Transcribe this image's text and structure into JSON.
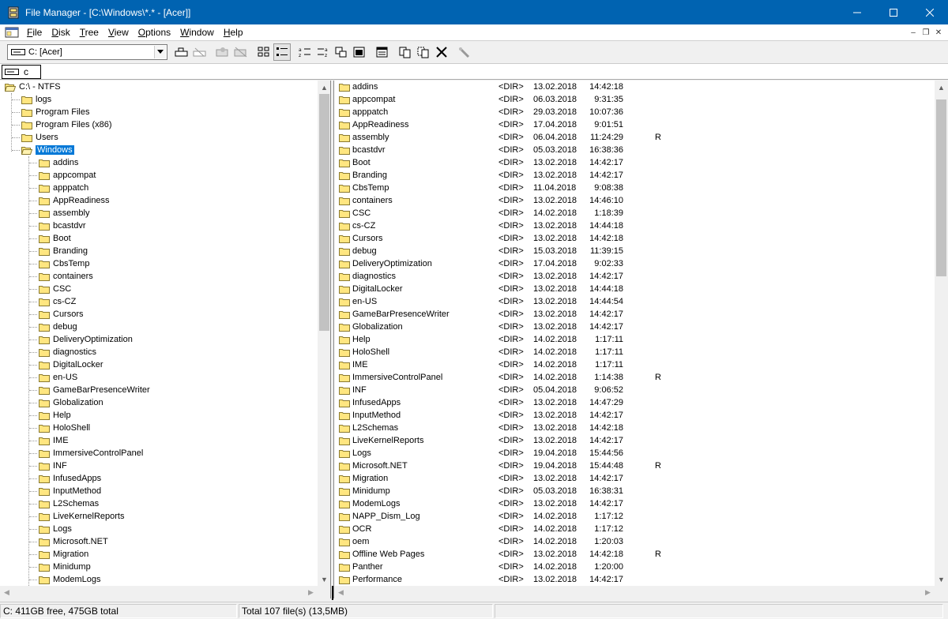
{
  "window": {
    "title": "File Manager - [C:\\Windows\\*.* - [Acer]]"
  },
  "menu": [
    {
      "key": "F",
      "rest": "ile"
    },
    {
      "key": "D",
      "rest": "isk"
    },
    {
      "key": "T",
      "rest": "ree"
    },
    {
      "key": "V",
      "rest": "iew"
    },
    {
      "key": "O",
      "rest": "ptions"
    },
    {
      "key": "W",
      "rest": "indow"
    },
    {
      "key": "H",
      "rest": "elp"
    }
  ],
  "drive_select": {
    "value": "C: [Acer]"
  },
  "drive_tab": {
    "label": "c"
  },
  "tree": {
    "root": "C:\\ - NTFS",
    "top_folders": [
      "logs",
      "Program Files",
      "Program Files (x86)",
      "Users"
    ],
    "selected": "Windows",
    "children": [
      "addins",
      "appcompat",
      "apppatch",
      "AppReadiness",
      "assembly",
      "bcastdvr",
      "Boot",
      "Branding",
      "CbsTemp",
      "containers",
      "CSC",
      "cs-CZ",
      "Cursors",
      "debug",
      "DeliveryOptimization",
      "diagnostics",
      "DigitalLocker",
      "en-US",
      "GameBarPresenceWriter",
      "Globalization",
      "Help",
      "HoloShell",
      "IME",
      "ImmersiveControlPanel",
      "INF",
      "InfusedApps",
      "InputMethod",
      "L2Schemas",
      "LiveKernelReports",
      "Logs",
      "Microsoft.NET",
      "Migration",
      "Minidump",
      "ModemLogs"
    ]
  },
  "files": [
    {
      "name": "addins",
      "type": "<DIR>",
      "date": "13.02.2018",
      "time": "14:42:18",
      "attr": ""
    },
    {
      "name": "appcompat",
      "type": "<DIR>",
      "date": "06.03.2018",
      "time": "9:31:35",
      "attr": ""
    },
    {
      "name": "apppatch",
      "type": "<DIR>",
      "date": "29.03.2018",
      "time": "10:07:36",
      "attr": ""
    },
    {
      "name": "AppReadiness",
      "type": "<DIR>",
      "date": "17.04.2018",
      "time": "9:01:51",
      "attr": ""
    },
    {
      "name": "assembly",
      "type": "<DIR>",
      "date": "06.04.2018",
      "time": "11:24:29",
      "attr": "R"
    },
    {
      "name": "bcastdvr",
      "type": "<DIR>",
      "date": "05.03.2018",
      "time": "16:38:36",
      "attr": ""
    },
    {
      "name": "Boot",
      "type": "<DIR>",
      "date": "13.02.2018",
      "time": "14:42:17",
      "attr": ""
    },
    {
      "name": "Branding",
      "type": "<DIR>",
      "date": "13.02.2018",
      "time": "14:42:17",
      "attr": ""
    },
    {
      "name": "CbsTemp",
      "type": "<DIR>",
      "date": "11.04.2018",
      "time": "9:08:38",
      "attr": ""
    },
    {
      "name": "containers",
      "type": "<DIR>",
      "date": "13.02.2018",
      "time": "14:46:10",
      "attr": ""
    },
    {
      "name": "CSC",
      "type": "<DIR>",
      "date": "14.02.2018",
      "time": "1:18:39",
      "attr": ""
    },
    {
      "name": "cs-CZ",
      "type": "<DIR>",
      "date": "13.02.2018",
      "time": "14:44:18",
      "attr": ""
    },
    {
      "name": "Cursors",
      "type": "<DIR>",
      "date": "13.02.2018",
      "time": "14:42:18",
      "attr": ""
    },
    {
      "name": "debug",
      "type": "<DIR>",
      "date": "15.03.2018",
      "time": "11:39:15",
      "attr": ""
    },
    {
      "name": "DeliveryOptimization",
      "type": "<DIR>",
      "date": "17.04.2018",
      "time": "9:02:33",
      "attr": ""
    },
    {
      "name": "diagnostics",
      "type": "<DIR>",
      "date": "13.02.2018",
      "time": "14:42:17",
      "attr": ""
    },
    {
      "name": "DigitalLocker",
      "type": "<DIR>",
      "date": "13.02.2018",
      "time": "14:44:18",
      "attr": ""
    },
    {
      "name": "en-US",
      "type": "<DIR>",
      "date": "13.02.2018",
      "time": "14:44:54",
      "attr": ""
    },
    {
      "name": "GameBarPresenceWriter",
      "type": "<DIR>",
      "date": "13.02.2018",
      "time": "14:42:17",
      "attr": ""
    },
    {
      "name": "Globalization",
      "type": "<DIR>",
      "date": "13.02.2018",
      "time": "14:42:17",
      "attr": ""
    },
    {
      "name": "Help",
      "type": "<DIR>",
      "date": "14.02.2018",
      "time": "1:17:11",
      "attr": ""
    },
    {
      "name": "HoloShell",
      "type": "<DIR>",
      "date": "14.02.2018",
      "time": "1:17:11",
      "attr": ""
    },
    {
      "name": "IME",
      "type": "<DIR>",
      "date": "14.02.2018",
      "time": "1:17:11",
      "attr": ""
    },
    {
      "name": "ImmersiveControlPanel",
      "type": "<DIR>",
      "date": "14.02.2018",
      "time": "1:14:38",
      "attr": "R"
    },
    {
      "name": "INF",
      "type": "<DIR>",
      "date": "05.04.2018",
      "time": "9:06:52",
      "attr": ""
    },
    {
      "name": "InfusedApps",
      "type": "<DIR>",
      "date": "13.02.2018",
      "time": "14:47:29",
      "attr": ""
    },
    {
      "name": "InputMethod",
      "type": "<DIR>",
      "date": "13.02.2018",
      "time": "14:42:17",
      "attr": ""
    },
    {
      "name": "L2Schemas",
      "type": "<DIR>",
      "date": "13.02.2018",
      "time": "14:42:18",
      "attr": ""
    },
    {
      "name": "LiveKernelReports",
      "type": "<DIR>",
      "date": "13.02.2018",
      "time": "14:42:17",
      "attr": ""
    },
    {
      "name": "Logs",
      "type": "<DIR>",
      "date": "19.04.2018",
      "time": "15:44:56",
      "attr": ""
    },
    {
      "name": "Microsoft.NET",
      "type": "<DIR>",
      "date": "19.04.2018",
      "time": "15:44:48",
      "attr": "R"
    },
    {
      "name": "Migration",
      "type": "<DIR>",
      "date": "13.02.2018",
      "time": "14:42:17",
      "attr": ""
    },
    {
      "name": "Minidump",
      "type": "<DIR>",
      "date": "05.03.2018",
      "time": "16:38:31",
      "attr": ""
    },
    {
      "name": "ModemLogs",
      "type": "<DIR>",
      "date": "13.02.2018",
      "time": "14:42:17",
      "attr": ""
    },
    {
      "name": "NAPP_Dism_Log",
      "type": "<DIR>",
      "date": "14.02.2018",
      "time": "1:17:12",
      "attr": ""
    },
    {
      "name": "OCR",
      "type": "<DIR>",
      "date": "14.02.2018",
      "time": "1:17:12",
      "attr": ""
    },
    {
      "name": "oem",
      "type": "<DIR>",
      "date": "14.02.2018",
      "time": "1:20:03",
      "attr": ""
    },
    {
      "name": "Offline Web Pages",
      "type": "<DIR>",
      "date": "13.02.2018",
      "time": "14:42:18",
      "attr": "R"
    },
    {
      "name": "Panther",
      "type": "<DIR>",
      "date": "14.02.2018",
      "time": "1:20:00",
      "attr": ""
    },
    {
      "name": "Performance",
      "type": "<DIR>",
      "date": "13.02.2018",
      "time": "14:42:17",
      "attr": ""
    }
  ],
  "status": {
    "free": "C: 411GB free,  475GB total",
    "total": "Total 107 file(s) (13,5MB)"
  },
  "colors": {
    "titlebar": "#0063b1",
    "selection": "#0078d7",
    "folder": "#ffe680"
  }
}
